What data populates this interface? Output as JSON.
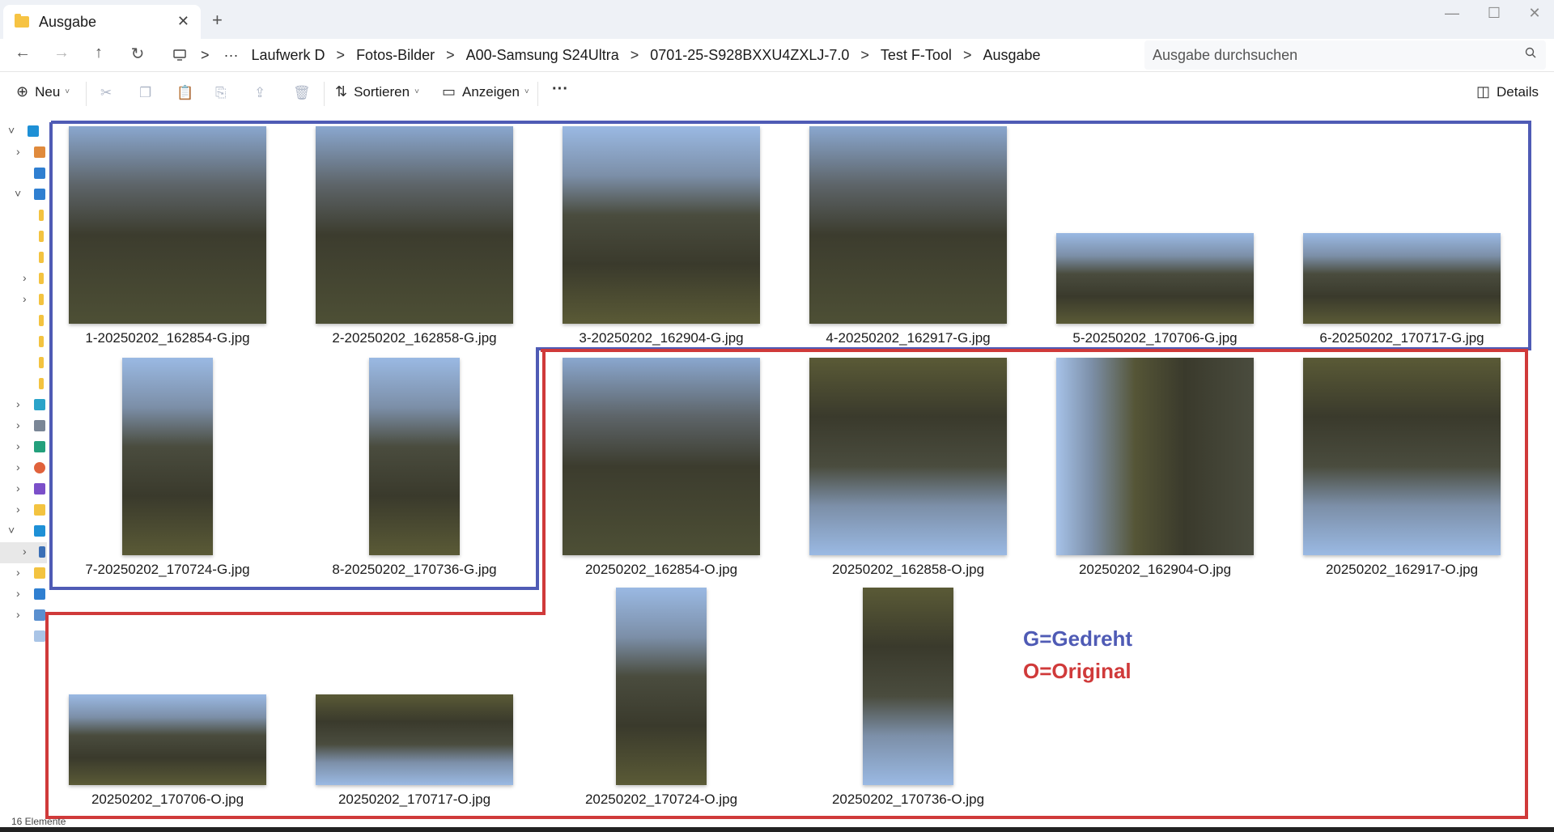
{
  "tab": {
    "title": "Ausgabe",
    "close": "✕",
    "add": "+"
  },
  "window_controls": {
    "minimize": "—",
    "maximize": "☐",
    "close": "✕"
  },
  "nav": {
    "back": "←",
    "forward": "→",
    "up": "↑",
    "refresh": "↻"
  },
  "breadcrumb": {
    "more": "···",
    "separator": ">",
    "items": [
      "Laufwerk D",
      "Fotos-Bilder",
      "A00-Samsung S24Ultra",
      "0701-25-S928BXXU4ZXLJ-7.0",
      "Test F-Tool",
      "Ausgabe"
    ]
  },
  "search": {
    "placeholder": "Ausgabe durchsuchen",
    "value": ""
  },
  "toolbar": {
    "new_label": "Neu",
    "sort_label": "Sortieren",
    "view_label": "Anzeigen",
    "more": "···",
    "details_label": "Details",
    "icons": [
      "cut-icon",
      "copy-icon",
      "paste-icon",
      "rename-icon",
      "share-icon",
      "delete-icon"
    ]
  },
  "files": [
    "1-20250202_162854-G.jpg",
    "2-20250202_162858-G.jpg",
    "3-20250202_162904-G.jpg",
    "4-20250202_162917-G.jpg",
    "5-20250202_170706-G.jpg",
    "6-20250202_170717-G.jpg",
    "7-20250202_170724-G.jpg",
    "8-20250202_170736-G.jpg",
    "20250202_162854-O.jpg",
    "20250202_162858-O.jpg",
    "20250202_162904-O.jpg",
    "20250202_162917-O.jpg",
    "20250202_170706-O.jpg",
    "20250202_170717-O.jpg",
    "20250202_170724-O.jpg",
    "20250202_170736-O.jpg"
  ],
  "legend": {
    "gedreht": "G=Gedreht",
    "original": "O=Original"
  },
  "annotation_colors": {
    "gedreht": "#4f5bb5",
    "original": "#d03a3a"
  },
  "status": {
    "count": "16 Elemente"
  }
}
